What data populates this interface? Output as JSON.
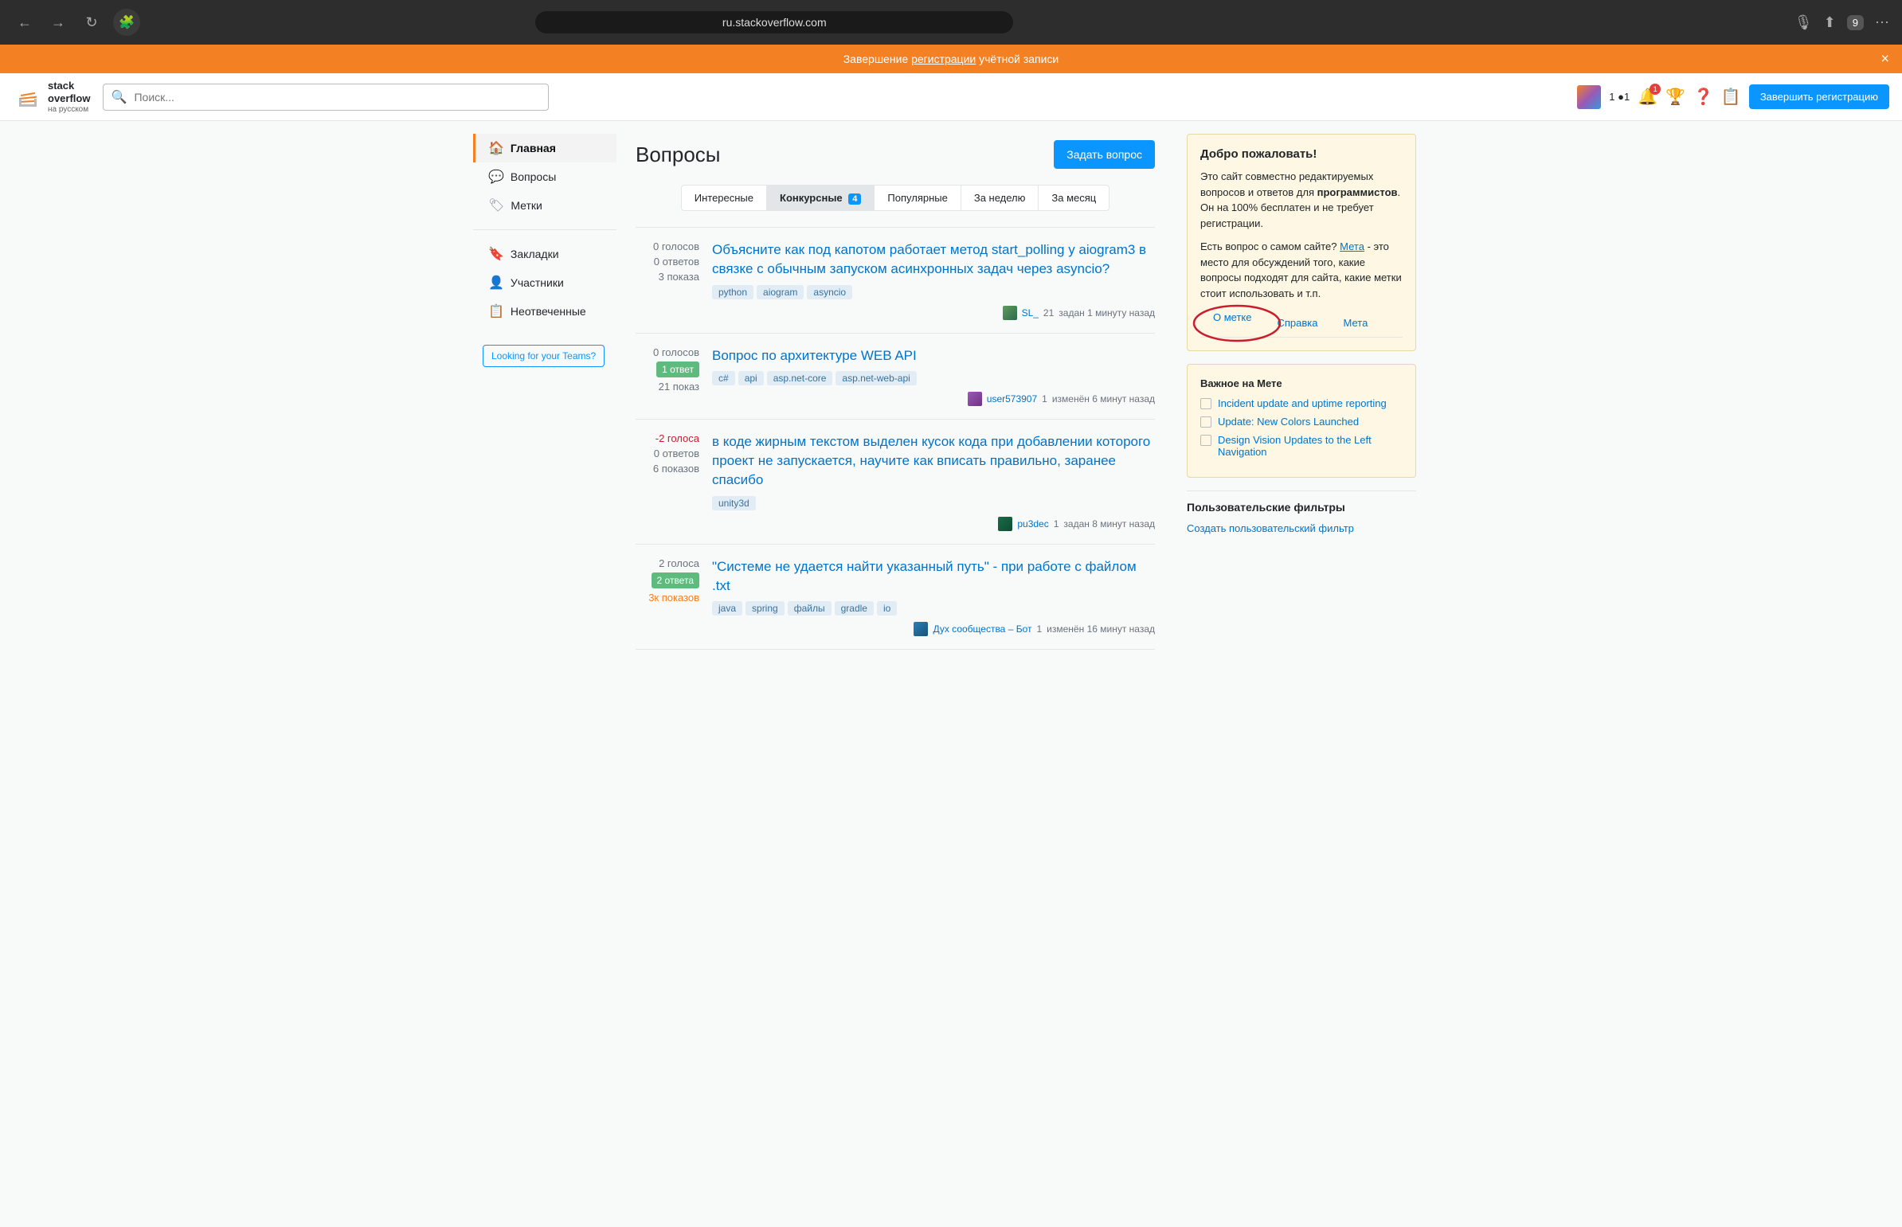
{
  "browser": {
    "url": "ru.stackoverflow.com",
    "back_title": "Back",
    "forward_title": "Forward",
    "reload_title": "Reload",
    "tab_count": "9",
    "mic_icon": "🎙",
    "share_icon": "⬆",
    "tabs_icon": "⊞",
    "more_icon": "⋯"
  },
  "banner": {
    "text_plain": "Завершение ",
    "text_link": "регистрации",
    "text_after": " учётной записи",
    "close_label": "×"
  },
  "header": {
    "logo_text": "stack\noverflow",
    "logo_sub": "на русском",
    "search_placeholder": "Поиск...",
    "register_btn": "Завершить регистрацию",
    "rep_text": "1  ●1"
  },
  "sidebar": {
    "items": [
      {
        "label": "Главная",
        "icon": "🏠",
        "active": true
      },
      {
        "label": "Вопросы",
        "icon": "💬",
        "active": false
      },
      {
        "label": "Метки",
        "icon": "🏷",
        "active": false
      },
      {
        "label": "Закладки",
        "icon": "🔖",
        "active": false
      },
      {
        "label": "Участники",
        "icon": "👤",
        "active": false
      },
      {
        "label": "Неотвеченные",
        "icon": "📋",
        "active": false
      }
    ],
    "teams_btn": "Looking for your Teams?"
  },
  "main": {
    "page_title": "Вопросы",
    "ask_btn": "Задать вопрос",
    "tabs": [
      {
        "label": "Интересные",
        "active": false,
        "badge": null
      },
      {
        "label": "Конкурсные",
        "active": true,
        "badge": "4"
      },
      {
        "label": "Популярные",
        "active": false,
        "badge": null
      },
      {
        "label": "За неделю",
        "active": false,
        "badge": null
      },
      {
        "label": "За месяц",
        "active": false,
        "badge": null
      }
    ],
    "questions": [
      {
        "votes": "0 голосов",
        "answers": "0 ответов",
        "views": "3 показа",
        "answers_count": "0",
        "has_answer": false,
        "title": "Объясните как под капотом работает метод start_polling у aiogram3 в связке с обычным запуском асинхронных задач через asyncio?",
        "tags": [
          "python",
          "aiogram",
          "asyncio"
        ],
        "user": "SL_",
        "user_rep": "21",
        "meta": "задан 1 минуту назад",
        "avatar_class": "av1"
      },
      {
        "votes": "0 голосов",
        "answers": "1 ответ",
        "views": "21 показ",
        "answers_count": "1",
        "has_answer": true,
        "title": "Вопрос по архитектуре WEB API",
        "tags": [
          "c#",
          "api",
          "asp.net-core",
          "asp.net-web-api"
        ],
        "user": "user573907",
        "user_rep": "1",
        "meta": "изменён 6 минут назад",
        "avatar_class": "av2"
      },
      {
        "votes": "-2 голоса",
        "answers": "0 ответов",
        "views": "6 показов",
        "answers_count": "0",
        "has_answer": false,
        "negative": true,
        "title": "в коде жирным текстом выделен кусок кода при добавлении которого проект не запускается, научите как вписать правильно, заранее спасибо",
        "tags": [
          "unity3d"
        ],
        "user": "pu3dec",
        "user_rep": "1",
        "meta": "задан 8 минут назад",
        "avatar_class": "av3"
      },
      {
        "votes": "2 голоса",
        "answers": "2 ответа",
        "views": "3к показов",
        "answers_count": "2",
        "has_answer": true,
        "title": "\"Системе не удается найти указанный путь\" - при работе с файлом .txt",
        "tags": [
          "java",
          "spring",
          "файлы",
          "gradle",
          "io"
        ],
        "user": "Дух сообщества ‒ Бот",
        "user_rep": "1",
        "meta": "изменён 16 минут назад",
        "avatar_class": "av4"
      }
    ]
  },
  "right_sidebar": {
    "welcome_title": "Добро пожаловать!",
    "welcome_text1": "Это сайт совместно редактируемых вопросов и ответов для ",
    "welcome_bold": "программистов",
    "welcome_text2": ". Он на 100% бесплатен и не требует регистрации.",
    "welcome_text3": "Есть вопрос о самом сайте? ",
    "welcome_meta_link": "Мета",
    "welcome_text4": " - это место для обсуждений того, какие вопросы подходят для сайта, какие метки стоит использовать и т.п.",
    "tabs": [
      {
        "label": "О метке"
      },
      {
        "label": "Справка"
      },
      {
        "label": "Мета"
      }
    ],
    "meta_section_title": "Важное на Мете",
    "meta_items": [
      {
        "label": "Incident update and uptime reporting"
      },
      {
        "label": "Update: New Colors Launched"
      },
      {
        "label": "Design Vision Updates to the Left Navigation"
      }
    ],
    "user_filters_title": "Пользовательские фильтры",
    "create_filter_link": "Создать пользовательский фильтр"
  }
}
